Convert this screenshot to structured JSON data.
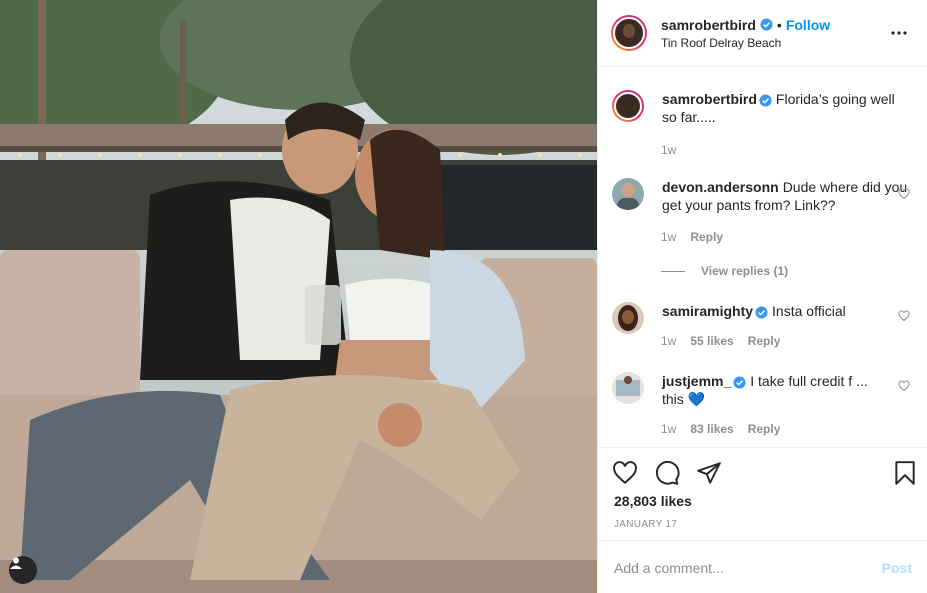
{
  "post": {
    "username": "samrobertbird",
    "follow_label": "Follow",
    "dot": "•",
    "location": "Tin Roof Delray Beach",
    "more_icon": "more-horizontal-icon"
  },
  "caption": {
    "username": "samrobertbird",
    "text": "Florida’s going well so far.....",
    "time": "1w"
  },
  "comments": [
    {
      "username": "devon.andersonn",
      "text": "Dude where did you get your pants from? Link??",
      "time": "1w",
      "likes": "",
      "reply": "Reply",
      "verified": false
    },
    {
      "username": "samiramighty",
      "text": "Insta official",
      "time": "1w",
      "likes": "55 likes",
      "reply": "Reply",
      "verified": true
    },
    {
      "username": "justjemm_",
      "text": "I take full credit f",
      "ellipsis": "...",
      "text2": "this",
      "emoji": "💙",
      "time": "1w",
      "likes": "83 likes",
      "reply": "Reply",
      "verified": true
    }
  ],
  "view_replies": "View replies (1)",
  "actions": {
    "likes": "28,803 likes",
    "date": "JANUARY 17"
  },
  "add_comment": {
    "placeholder": "Add a comment...",
    "post_label": "Post"
  },
  "colors": {
    "accent": "#0095f6",
    "verified": "#3897f0",
    "post_disabled": "#b2dffc"
  }
}
